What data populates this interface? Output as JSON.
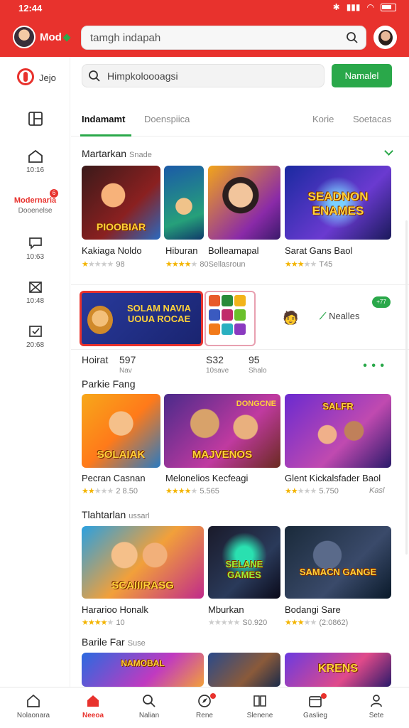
{
  "status": {
    "time": "12:44"
  },
  "header": {
    "name": "Mod",
    "search_placeholder": "tamgh indapah"
  },
  "sidebar": {
    "logo_label": "Jejo",
    "items": [
      {
        "label": "",
        "icon": "layout-icon"
      },
      {
        "label": "10:16",
        "icon": "home-icon"
      },
      {
        "label": "Modernaria",
        "sublabel": "Dooenelse",
        "icon": "",
        "badge": "6"
      },
      {
        "label": "10:63",
        "icon": "chat-icon"
      },
      {
        "label": "10:48",
        "icon": "mail-icon"
      },
      {
        "label": "20:68",
        "icon": "ticket-icon"
      }
    ]
  },
  "main": {
    "search_placeholder": "Himpkoloooagsi",
    "green_button": "Namalel",
    "tabs": [
      "Indamamt",
      "Doenspiica",
      "Korie",
      "Soetacas"
    ],
    "sections": [
      {
        "title": "Martarkan",
        "sub": "Snade"
      },
      {
        "title": "Parkie Fang",
        "sub": ""
      },
      {
        "title": "Tlahtarlan",
        "sub": "ussarl"
      },
      {
        "title": "Barile Far",
        "sub": "Suse"
      }
    ],
    "row1": [
      {
        "title": "Kakiaga Noldo",
        "rating": "98",
        "stars": 1,
        "art": "PIOOBIAR"
      },
      {
        "title": "Hiburan",
        "rating": "",
        "stars": 4,
        "art": ""
      },
      {
        "title": "Bolleamapal",
        "rating": "80Sellasroun",
        "stars": 4,
        "art": ""
      },
      {
        "title": "Sarat Gans Baol",
        "rating": "T45",
        "stars": 3,
        "art": "SEADNON ENAMES"
      }
    ],
    "promo": {
      "banner_text": "SOLAM NAVIA UOUA ROCAE",
      "link": "Nealles",
      "badge": "+77"
    },
    "stats": [
      {
        "value": "Hoirat",
        "label": ""
      },
      {
        "value": "597",
        "label": "Nav"
      },
      {
        "value": "S32",
        "label": "10save"
      },
      {
        "value": "95",
        "label": "Shalo"
      }
    ],
    "row2": [
      {
        "title": "Pecran Casnan",
        "rating": "2 8.50",
        "stars": 2,
        "art": "SOLAIAK"
      },
      {
        "title": "Melonelios Kecfeagi",
        "rating": "5.565",
        "stars": 4,
        "art": "MAJVENOS"
      },
      {
        "title": "Glent Kickalsfader Baol",
        "rating": "5.750",
        "stars": 2,
        "extra": "Kasl",
        "art": "SALFR"
      }
    ],
    "row3": [
      {
        "title": "Hararioo Honalk",
        "rating": "10",
        "stars": 4,
        "art": "SCAIIIRASG"
      },
      {
        "title": "Mburkan",
        "rating": "S0.920",
        "stars": 0,
        "art": "SELANE GAMES"
      },
      {
        "title": "Bodangi Sare",
        "rating": "(2:0862)",
        "stars": 3,
        "art": "SAMACN GANGE"
      }
    ],
    "row4": [
      {
        "art": "NAMOBAL"
      },
      {
        "art": ""
      },
      {
        "art": "KRENS"
      }
    ]
  },
  "bottom_nav": [
    {
      "label": "Nolaonara",
      "icon": "home-icon"
    },
    {
      "label": "Neeoa",
      "icon": "home-filled-icon",
      "active": true
    },
    {
      "label": "Nalian",
      "icon": "search-icon"
    },
    {
      "label": "Rene",
      "icon": "compass-icon"
    },
    {
      "label": "Slenene",
      "icon": "book-icon"
    },
    {
      "label": "Gaslieg",
      "icon": "calendar-icon"
    },
    {
      "label": "Sete",
      "icon": "person-icon"
    }
  ],
  "colors": {
    "brand_red": "#e8322d",
    "accent_green": "#2aa84a",
    "star": "#f3b400"
  }
}
